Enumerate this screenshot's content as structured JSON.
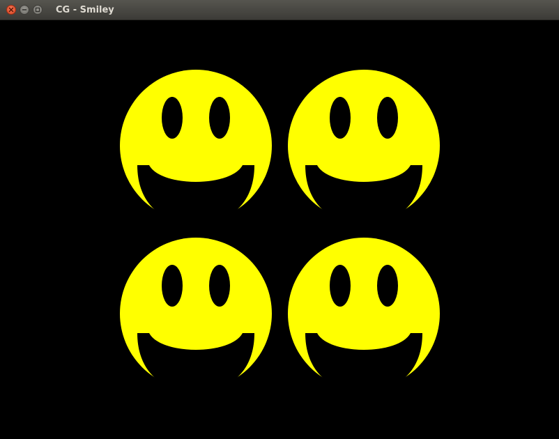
{
  "window": {
    "title": "CG - Smiley"
  },
  "titlebar_controls": [
    {
      "name": "close-button",
      "icon": "close-icon"
    },
    {
      "name": "minimize-button",
      "icon": "minimize-icon"
    },
    {
      "name": "maximize-button",
      "icon": "maximize-icon"
    }
  ],
  "canvas": {
    "background_color": "#000000",
    "smiley_color": "#ffff00",
    "feature_color": "#000000",
    "smiley_count": 4
  }
}
